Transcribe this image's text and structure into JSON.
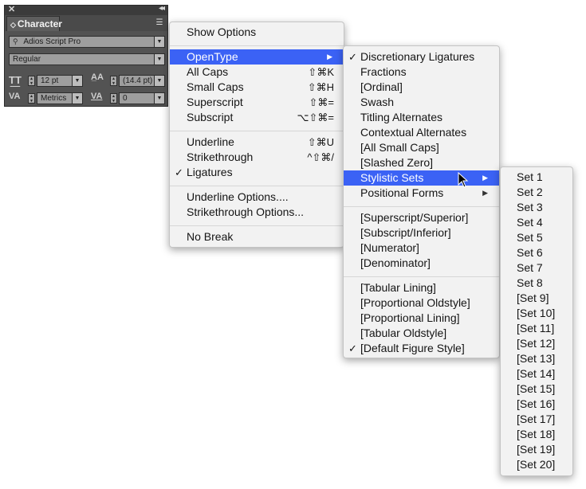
{
  "character_panel": {
    "title": "Character",
    "font_family": "Adios Script Pro",
    "font_style": "Regular",
    "font_size": "12 pt",
    "leading": "(14.4 pt)",
    "kerning": "Metrics",
    "tracking": "0"
  },
  "panel_menu": {
    "groups": [
      [
        {
          "label": "Show Options"
        }
      ],
      [
        {
          "label": "OpenType",
          "submenu": true,
          "highlighted": true
        },
        {
          "label": "All Caps",
          "shortcut": "⇧⌘K"
        },
        {
          "label": "Small Caps",
          "shortcut": "⇧⌘H"
        },
        {
          "label": "Superscript",
          "shortcut": "⇧⌘="
        },
        {
          "label": "Subscript",
          "shortcut": "⌥⇧⌘="
        }
      ],
      [
        {
          "label": "Underline",
          "shortcut": "⇧⌘U"
        },
        {
          "label": "Strikethrough",
          "shortcut": "^⇧⌘/"
        },
        {
          "label": "Ligatures",
          "checked": true
        }
      ],
      [
        {
          "label": "Underline Options...."
        },
        {
          "label": "Strikethrough Options..."
        }
      ],
      [
        {
          "label": "No Break"
        }
      ]
    ]
  },
  "opentype_menu": {
    "groups": [
      [
        {
          "label": "Discretionary Ligatures",
          "checked": true
        },
        {
          "label": "Fractions"
        },
        {
          "label": "[Ordinal]"
        },
        {
          "label": "Swash"
        },
        {
          "label": "Titling Alternates"
        },
        {
          "label": "Contextual Alternates"
        },
        {
          "label": "[All Small Caps]"
        },
        {
          "label": "[Slashed Zero]"
        },
        {
          "label": "Stylistic Sets",
          "submenu": true,
          "highlighted": true
        },
        {
          "label": "Positional Forms",
          "submenu": true
        }
      ],
      [
        {
          "label": "[Superscript/Superior]"
        },
        {
          "label": "[Subscript/Inferior]"
        },
        {
          "label": "[Numerator]"
        },
        {
          "label": "[Denominator]"
        }
      ],
      [
        {
          "label": "[Tabular Lining]"
        },
        {
          "label": "[Proportional Oldstyle]"
        },
        {
          "label": "[Proportional Lining]"
        },
        {
          "label": "[Tabular Oldstyle]"
        },
        {
          "label": "[Default Figure Style]",
          "checked": true
        }
      ]
    ]
  },
  "stylistic_sets_menu": {
    "items": [
      "Set 1",
      "Set 2",
      "Set 3",
      "Set 4",
      "Set 5",
      "Set 6",
      "Set 7",
      "Set 8",
      "[Set 9]",
      "[Set 10]",
      "[Set 11]",
      "[Set 12]",
      "[Set 13]",
      "[Set 14]",
      "[Set 15]",
      "[Set 16]",
      "[Set 17]",
      "[Set 18]",
      "[Set 19]",
      "[Set 20]"
    ]
  },
  "icons": {
    "check": "✓",
    "submenu_arrow": "▶",
    "dropdown_arrow": "▼",
    "close": "✕",
    "collapse": "◂◂",
    "panel_menu": "☰"
  }
}
